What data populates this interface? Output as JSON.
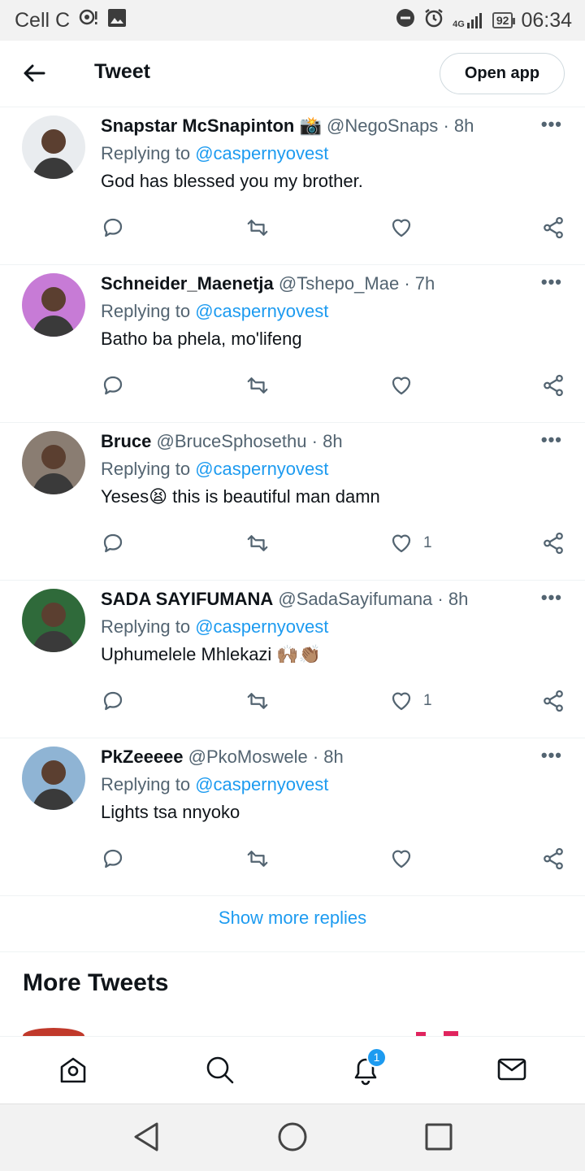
{
  "status_bar": {
    "carrier": "Cell C",
    "network": "4G",
    "battery": "92",
    "time": "06:34"
  },
  "header": {
    "title": "Tweet",
    "open_app_label": "Open app"
  },
  "tweets": [
    {
      "name": "Snapstar McSnapinton 📸",
      "handle": "@NegoSnaps",
      "time": "8h",
      "reply_prefix": "Replying to",
      "reply_to": "@caspernyovest",
      "text": "God has blessed you my brother.",
      "likes": "",
      "avatar_color": "#e9ecef"
    },
    {
      "name": "Schneider_Maenetja",
      "handle": "@Tshepo_Mae",
      "time": "7h",
      "reply_prefix": "Replying to",
      "reply_to": "@caspernyovest",
      "text": "Batho ba phela, mo'lifeng",
      "likes": "",
      "avatar_color": "#c77bd6"
    },
    {
      "name": "Bruce",
      "handle": "@BruceSphosethu",
      "time": "8h",
      "reply_prefix": "Replying to",
      "reply_to": "@caspernyovest",
      "text": "Yeses😫 this is beautiful man damn",
      "likes": "1",
      "avatar_color": "#8a7d72"
    },
    {
      "name": "SADA SAYIFUMANA",
      "handle": "@SadaSayifumana",
      "time": "8h",
      "reply_prefix": "Replying to",
      "reply_to": "@caspernyovest",
      "text": "Uphumelele Mhlekazi 🙌🏽👏🏽",
      "likes": "1",
      "avatar_color": "#2f6a3a"
    },
    {
      "name": "PkZeeeee",
      "handle": "@PkoMoswele",
      "time": "8h",
      "reply_prefix": "Replying to",
      "reply_to": "@caspernyovest",
      "text": "Lights tsa nnyoko",
      "likes": "",
      "avatar_color": "#8fb4d4"
    }
  ],
  "show_more_label": "Show more replies",
  "more_tweets_title": "More Tweets",
  "bottom_nav": {
    "notification_count": "1"
  },
  "colors": {
    "accent": "#1d9bf0",
    "secondary_text": "#536471",
    "primary_text": "#0f1419"
  }
}
